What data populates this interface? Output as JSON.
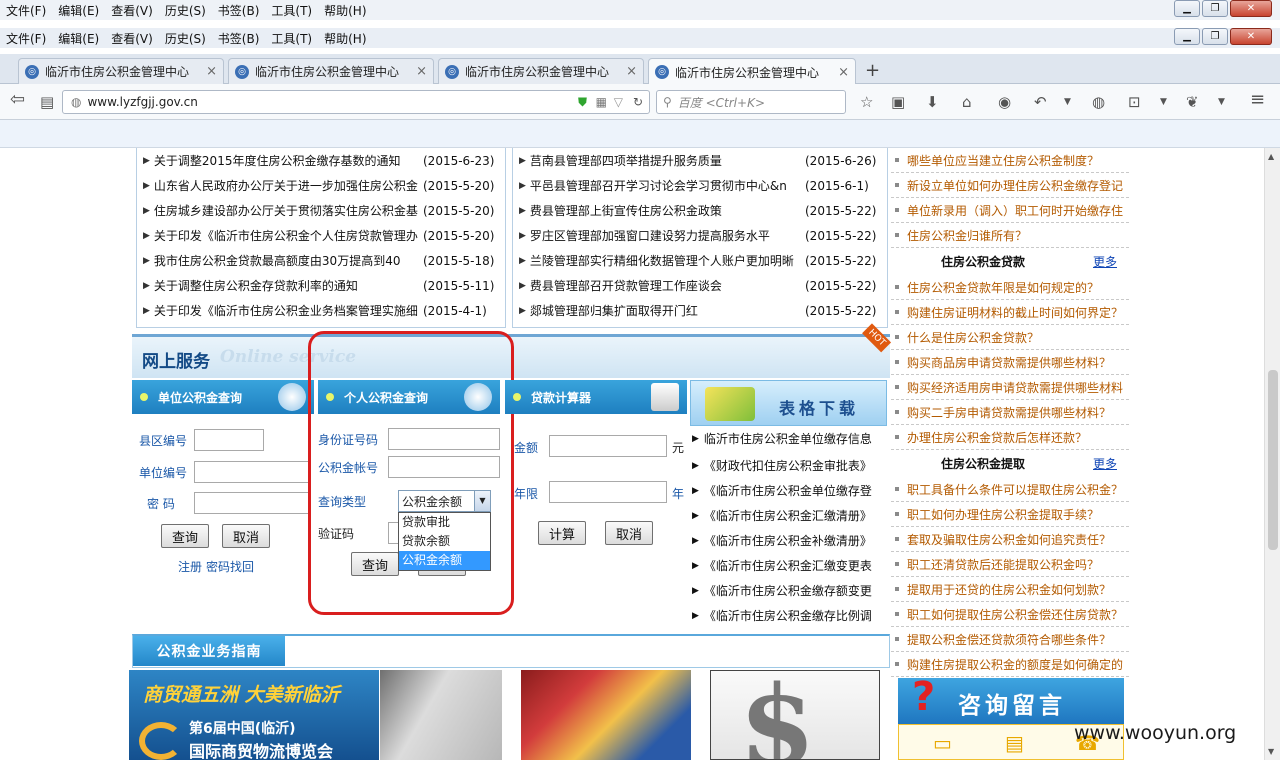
{
  "browser": {
    "menu": [
      "文件(F)",
      "编辑(E)",
      "查看(V)",
      "历史(S)",
      "书签(B)",
      "工具(T)",
      "帮助(H)"
    ],
    "tabs": [
      "临沂市住房公积金管理中心",
      "临沂市住房公积金管理中心",
      "临沂市住房公积金管理中心",
      "临沂市住房公积金管理中心"
    ],
    "url": "www.lyzfgjj.gov.cn",
    "search_placeholder": "百度 <Ctrl+K>"
  },
  "news_left": [
    {
      "title": "关于调整2015年度住房公积金缴存基数的通知",
      "date": "(2015-6-23)"
    },
    {
      "title": "山东省人民政府办公厅关于进一步加强住房公积金",
      "date": "(2015-5-20)"
    },
    {
      "title": "住房城乡建设部办公厅关于贯彻落实住房公积金基",
      "date": "(2015-5-20)"
    },
    {
      "title": "关于印发《临沂市住房公积金个人住房贷款管理办",
      "date": "(2015-5-20)"
    },
    {
      "title": "我市住房公积金贷款最高额度由30万提高到40",
      "date": "(2015-5-18)"
    },
    {
      "title": "关于调整住房公积金存贷款利率的通知",
      "date": "(2015-5-11)"
    },
    {
      "title": "关于印发《临沂市住房公积金业务档案管理实施细",
      "date": "(2015-4-1)"
    }
  ],
  "news_mid": [
    {
      "title": "莒南县管理部四项举措提升服务质量",
      "date": "(2015-6-26)"
    },
    {
      "title": "平邑县管理部召开学习讨论会学习贯彻市中心&n",
      "date": "(2015-6-1)"
    },
    {
      "title": "费县管理部上街宣传住房公积金政策",
      "date": "(2015-5-22)"
    },
    {
      "title": "罗庄区管理部加强窗口建设努力提高服务水平",
      "date": "(2015-5-22)"
    },
    {
      "title": "兰陵管理部实行精细化数据管理个人账户更加明晰",
      "date": "(2015-5-22)"
    },
    {
      "title": "费县管理部召开贷款管理工作座谈会",
      "date": "(2015-5-22)"
    },
    {
      "title": "郯城管理部归集扩面取得开门红",
      "date": "(2015-5-22)"
    }
  ],
  "right": {
    "group1": [
      "哪些单位应当建立住房公积金制度？",
      "新设立单位如何办理住房公积金缴存登记",
      "单位新录用（调入）职工何时开始缴存住",
      "住房公积金归谁所有？"
    ],
    "loan_head": "住房公积金贷款",
    "more": "更多",
    "group2": [
      "住房公积金贷款年限是如何规定的？",
      "购建住房证明材料的截止时间如何界定？",
      "什么是住房公积金贷款？",
      "购买商品房申请贷款需提供哪些材料？",
      "购买经济适用房申请贷款需提供哪些材料",
      "购买二手房申请贷款需提供哪些材料？",
      "办理住房公积金贷款后怎样还款？"
    ],
    "withdraw_head": "住房公积金提取",
    "group3": [
      "职工具备什么条件可以提取住房公积金？",
      "职工如何办理住房公积金提取手续？",
      "套取及骗取住房公积金如何追究责任？",
      "职工还清贷款后还能提取公积金吗？",
      "提取用于还贷的住房公积金如何划款？",
      "职工如何提取住房公积金偿还住房贷款？",
      "提取公积金偿还贷款须符合哪些条件？",
      "购建住房提取公积金的额度是如何确定的"
    ],
    "consult": "咨询留言"
  },
  "services": {
    "title_cn": "网上服务",
    "title_en": "Online service",
    "hot": "HOT",
    "unit": {
      "head": "单位公积金查询",
      "county": "县区编号",
      "unit_no": "单位编号",
      "password": "密  码",
      "query": "查询",
      "cancel": "取消",
      "register": "注册",
      "recover": "密码找回"
    },
    "personal": {
      "head": "个人公积金查询",
      "id": "身份证号码",
      "account": "公积金帐号",
      "type": "查询类型",
      "captcha": "验证码",
      "selected": "公积金余额",
      "options": [
        "贷款审批",
        "贷款余额",
        "公积金余额"
      ],
      "query": "查询"
    },
    "calc": {
      "head": "贷款计算器",
      "amount": "金额",
      "amount_unit": "元",
      "years": "年限",
      "years_unit": "年",
      "compute": "计算",
      "cancel": "取消"
    }
  },
  "downloads": {
    "head": "表格下载",
    "items": [
      "临沂市住房公积金单位缴存信息",
      "《财政代扣住房公积金审批表》",
      "《临沂市住房公积金单位缴存登",
      "《临沂市住房公积金汇缴清册》",
      "《临沂市住房公积金补缴清册》",
      "《临沂市住房公积金汇缴变更表",
      "《临沂市住房公积金缴存额变更",
      "《临沂市住房公积金缴存比例调"
    ]
  },
  "guide": "公积金业务指南",
  "banner": {
    "slogan": "商贸通五洲 大美新临沂",
    "expo_line1": "第6届中国(临沂)",
    "expo_line2": "国际商贸物流博览会"
  },
  "watermark": "www.wooyun.org"
}
